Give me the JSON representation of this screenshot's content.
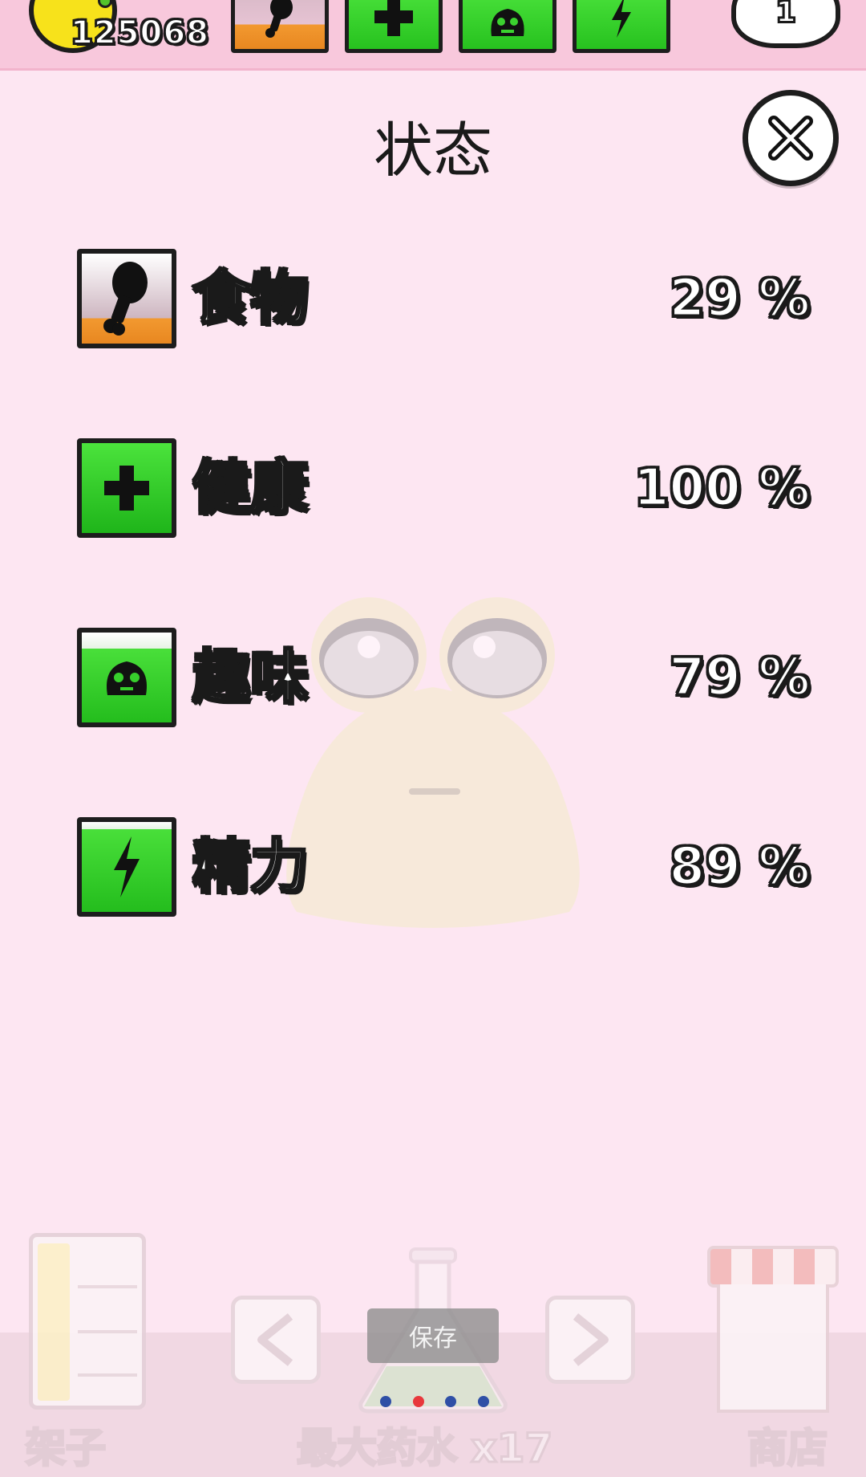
{
  "topbar": {
    "coins": "125068",
    "level": "1",
    "stat_icons": [
      "drumstick-icon",
      "plus-icon",
      "pou-face-icon",
      "lightning-icon"
    ]
  },
  "panel": {
    "title": "状态",
    "close_icon": "close-x-icon"
  },
  "stats": [
    {
      "label": "食物",
      "value": "29 %",
      "level": 0.29,
      "icon": "drumstick-icon"
    },
    {
      "label": "健康",
      "value": "100 %",
      "level": 1.0,
      "icon": "plus-icon"
    },
    {
      "label": "趣味",
      "value": "79 %",
      "level": 0.79,
      "icon": "pou-face-icon"
    },
    {
      "label": "精力",
      "value": "89 %",
      "level": 0.89,
      "icon": "lightning-icon"
    }
  ],
  "bottom": {
    "left_label": "架子",
    "center_label": "最大药水 x17",
    "right_label": "商店"
  },
  "overlay": {
    "save_label": "保存",
    "page_count": 4,
    "active_page": 2
  },
  "colors": {
    "background": "#fde6f2",
    "topbar": "#f8c8dc",
    "green": "#2fcc25",
    "food_orange": "#f29930",
    "outline": "#1d1d1d",
    "dot_active": "#e8383c",
    "dot_inactive": "#2f4fa6"
  }
}
